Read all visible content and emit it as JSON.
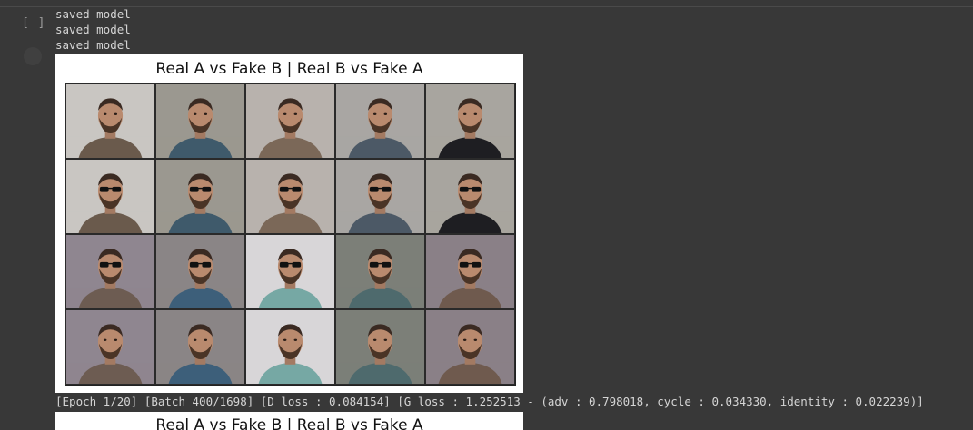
{
  "cell": {
    "execution_count": "[ ]",
    "log_lines": [
      "saved model",
      "saved model",
      "saved model"
    ],
    "figure_title": "Real A vs Fake B | Real B vs Fake A",
    "status": "[Epoch 1/20] [Batch 400/1698] [D loss : 0.084154] [G loss : 1.252513 - (adv : 0.798018, cycle : 0.034330, identity : 0.022239)]",
    "next_figure_title": "Real A vs Fake B | Real B vs Fake A"
  },
  "grid": {
    "rows": [
      [
        {
          "bg": "#c9c6c2",
          "shirt": "#6a5a4c",
          "glasses": false
        },
        {
          "bg": "#9b9890",
          "shirt": "#3f5a6b",
          "glasses": false
        },
        {
          "bg": "#b8b2ad",
          "shirt": "#7b6858",
          "glasses": false
        },
        {
          "bg": "#a9a6a3",
          "shirt": "#4c5966",
          "glasses": false
        },
        {
          "bg": "#a8a59f",
          "shirt": "#1e1e22",
          "glasses": false
        }
      ],
      [
        {
          "bg": "#c9c6c2",
          "shirt": "#6a5a4c",
          "glasses": true
        },
        {
          "bg": "#9b9890",
          "shirt": "#3f5a6b",
          "glasses": true
        },
        {
          "bg": "#b8b2ad",
          "shirt": "#7b6858",
          "glasses": true
        },
        {
          "bg": "#a9a6a3",
          "shirt": "#4c5966",
          "glasses": true
        },
        {
          "bg": "#a8a59f",
          "shirt": "#1e1e22",
          "glasses": true
        }
      ],
      [
        {
          "bg": "#8f8690",
          "shirt": "#6d5c52",
          "glasses": true
        },
        {
          "bg": "#8a8586",
          "shirt": "#3d5f7a",
          "glasses": true
        },
        {
          "bg": "#d8d6d8",
          "shirt": "#76a8a4",
          "glasses": true
        },
        {
          "bg": "#7c7f78",
          "shirt": "#4e6a6d",
          "glasses": true
        },
        {
          "bg": "#8a8087",
          "shirt": "#6f5a4e",
          "glasses": true
        }
      ],
      [
        {
          "bg": "#8f8690",
          "shirt": "#6d5c52",
          "glasses": false
        },
        {
          "bg": "#8a8586",
          "shirt": "#3d5f7a",
          "glasses": false
        },
        {
          "bg": "#d8d6d8",
          "shirt": "#76a8a4",
          "glasses": false
        },
        {
          "bg": "#7c7f78",
          "shirt": "#4e6a6d",
          "glasses": false
        },
        {
          "bg": "#8a8087",
          "shirt": "#6f5a4e",
          "glasses": false
        }
      ]
    ]
  }
}
